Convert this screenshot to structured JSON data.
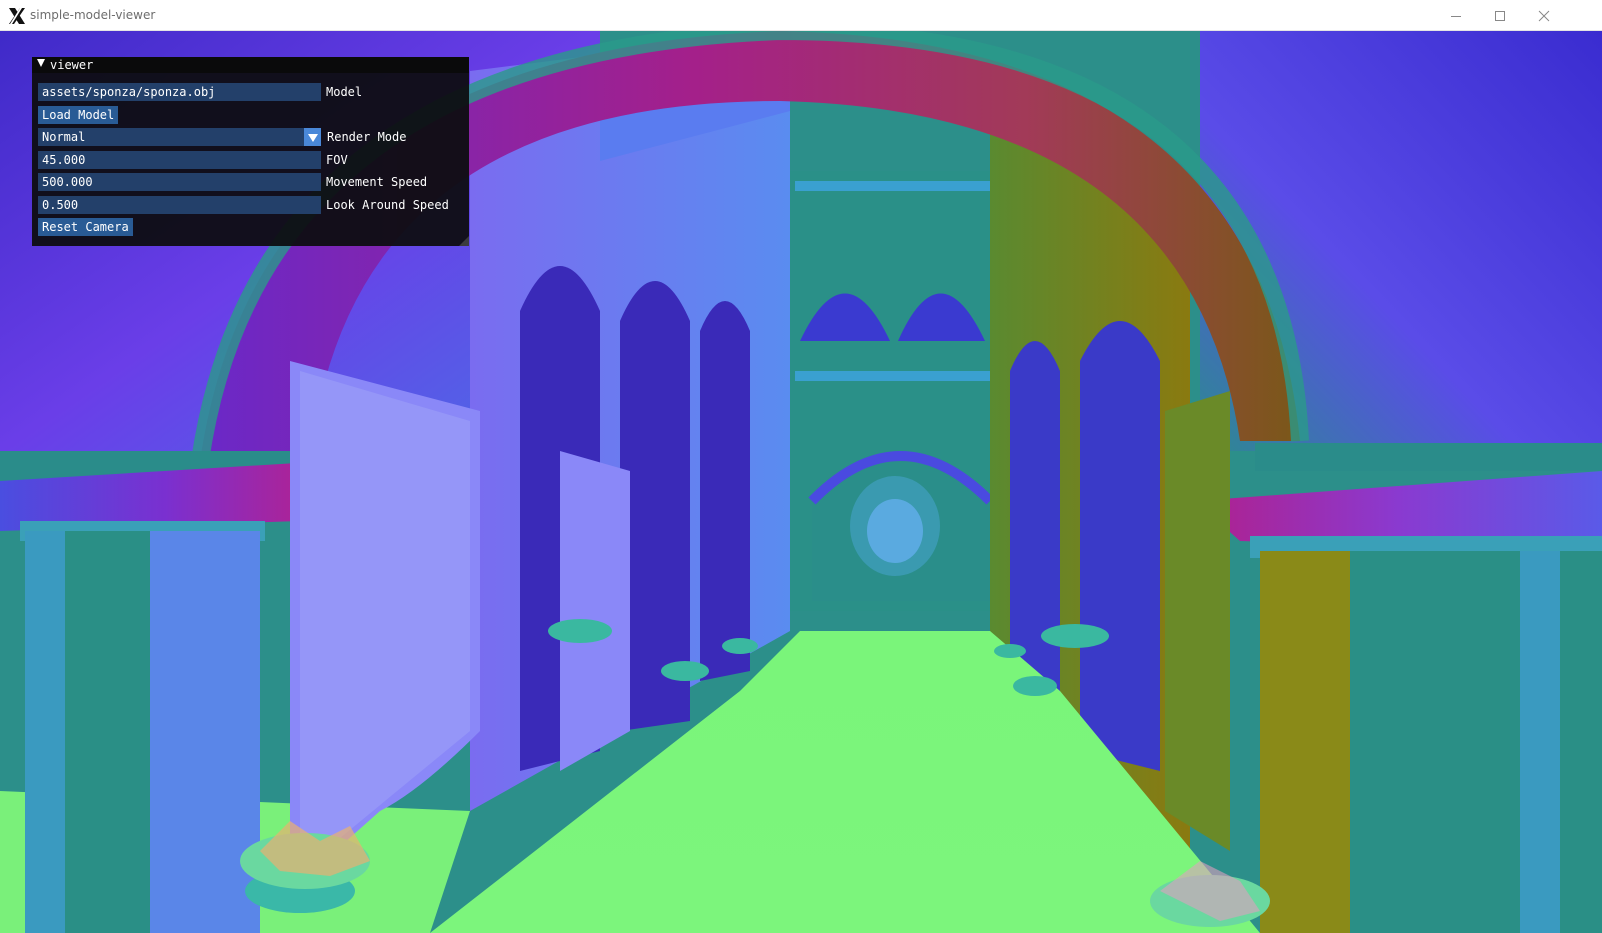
{
  "window": {
    "title": "simple-model-viewer"
  },
  "panel": {
    "title": "viewer",
    "model_path": "assets/sponza/sponza.obj",
    "model_label": "Model",
    "load_button": "Load Model",
    "render_mode_value": "Normal",
    "render_mode_label": "Render Mode",
    "fov_value": "45.000",
    "fov_label": "FOV",
    "movement_speed_value": "500.000",
    "movement_speed_label": "Movement Speed",
    "look_speed_value": "0.500",
    "look_speed_label": "Look Around Speed",
    "reset_button": "Reset Camera"
  },
  "icons": {
    "app": "x-logo-icon",
    "minimize": "minimize-icon",
    "maximize": "maximize-icon",
    "close": "close-icon",
    "collapse": "collapse-arrow-icon",
    "combo": "chevron-down-icon"
  },
  "colors": {
    "field_bg": "#23406a",
    "button_bg": "#295b95",
    "combo_arrow": "#4a88d8",
    "panel_bg": "#0d0d10"
  }
}
